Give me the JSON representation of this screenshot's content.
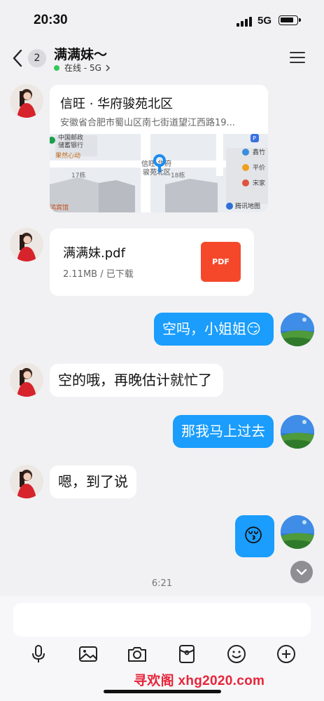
{
  "status_bar": {
    "time": "20:30",
    "network": "5G"
  },
  "header": {
    "unread_count": "2",
    "contact_name": "满满妹～",
    "status": "在线 - 5G",
    "colors": {
      "online": "#34c759"
    }
  },
  "messages": [
    {
      "type": "location",
      "from": "contact",
      "title": "信旺 · 华府骏苑北区",
      "address": "安徽省合肥市蜀山区南七街道望江西路19...",
      "map_labels": [
        "中国邮政",
        "储蓄银行",
        "果然心动",
        "17栋",
        "18栋",
        "信旺·华府",
        "骏苑北区",
        "鑫竹",
        "平价",
        "宋家",
        "鸿宾馆",
        "腾讯地图"
      ]
    },
    {
      "type": "file",
      "from": "contact",
      "name": "满满妹.pdf",
      "meta": "2.11MB / 已下载",
      "icon_label": "PDF"
    },
    {
      "type": "text",
      "from": "me",
      "text": "空吗，小姐姐😏"
    },
    {
      "type": "text",
      "from": "contact",
      "text": "空的哦，再晚估计就忙了"
    },
    {
      "type": "text",
      "from": "me",
      "text": "那我马上过去"
    },
    {
      "type": "text",
      "from": "contact",
      "text": "嗯，到了说"
    },
    {
      "type": "sticker",
      "from": "me",
      "text": "😚"
    }
  ],
  "timestamp": "6:21",
  "input": {
    "placeholder": ""
  },
  "toolbar": {
    "icons": [
      "microphone-icon",
      "image-icon",
      "camera-icon",
      "red-packet-icon",
      "emoji-icon",
      "plus-icon"
    ]
  },
  "watermark": "寻欢阁 xhg2020.com",
  "colors": {
    "outgoing_bubble": "#1a9dfc",
    "pdf": "#f5482b",
    "background": "#f1f1f3"
  }
}
